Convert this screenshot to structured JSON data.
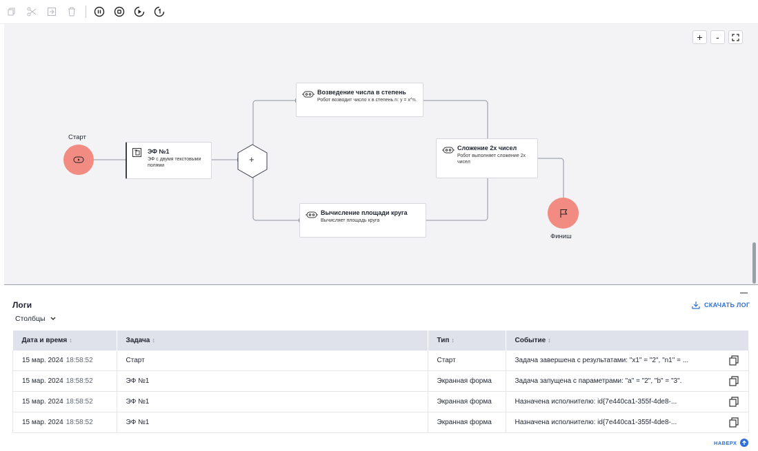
{
  "toolbar": {
    "icons": [
      "copy-icon",
      "cut-icon",
      "paste-icon",
      "trash-icon",
      "pause-icon",
      "stop-icon",
      "step-icon",
      "restart-icon"
    ]
  },
  "zoom": {
    "in_label": "+",
    "out_label": "-"
  },
  "diagram": {
    "start_label": "Старт",
    "finish_label": "Финиш",
    "nodes": {
      "ef1": {
        "title": "ЭФ №1",
        "desc": "ЭФ с двумя текстовыми полями"
      },
      "power": {
        "title": "Возведение числа в степень",
        "desc": "Робот возводит число x в степень n: y = x^n."
      },
      "sum": {
        "title": "Сложение 2х чисел",
        "desc": "Робот выполняет сложение 2х чисел"
      },
      "circle": {
        "title": "Вычисление площади круга",
        "desc": "Вычисляет площадь круга"
      }
    },
    "gateway_label": "+"
  },
  "logs": {
    "title": "Логи",
    "columns_button": "Столбцы",
    "download_label": "СКАЧАТЬ ЛОГ",
    "headers": [
      "Дата и время",
      "Задача",
      "Тип",
      "Событие"
    ],
    "rows": [
      {
        "date": "15 мар. 2024",
        "time": "18:58:52",
        "task": "Старт",
        "type": "Старт",
        "event": "Задача завершена с результатами: \"x1\" = \"2\", \"n1\" = ..."
      },
      {
        "date": "15 мар. 2024",
        "time": "18:58:52",
        "task": "ЭФ №1",
        "type": "Экранная форма",
        "event": "Задача запущена с параметрами: \"a\" = \"2\", \"b\" = \"3\"."
      },
      {
        "date": "15 мар. 2024",
        "time": "18:58:52",
        "task": "ЭФ №1",
        "type": "Экранная форма",
        "event": "Назначена исполнителю: id{7e440ca1-355f-4de8-..."
      },
      {
        "date": "15 мар. 2024",
        "time": "18:58:52",
        "task": "ЭФ №1",
        "type": "Экранная форма",
        "event": "Назначена исполнителю: id{7e440ca1-355f-4de8-..."
      }
    ],
    "top_link": "НАВЕРХ"
  },
  "colors": {
    "accent": "#2d6fd6",
    "node_circle": "#f28b82",
    "header_bg": "#dfe2ea",
    "canvas_bg": "#f3f3f5"
  }
}
